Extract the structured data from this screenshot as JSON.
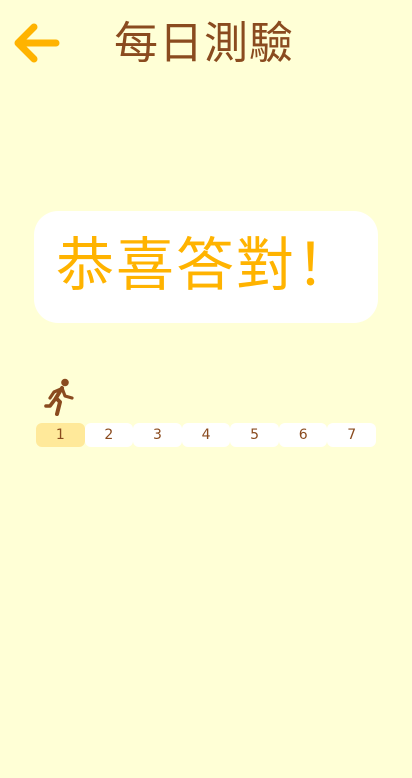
{
  "header": {
    "back_icon": "arrow-left-icon",
    "title": "每日測驗"
  },
  "result": {
    "message": "恭喜答對！"
  },
  "progress": {
    "runner_icon": "running-person-icon",
    "current": 1,
    "steps": [
      "1",
      "2",
      "3",
      "4",
      "5",
      "6",
      "7"
    ]
  },
  "colors": {
    "background": "#FFFFD6",
    "accent": "#FFB300",
    "title": "#8A4B1F",
    "active_step": "#FFE99A",
    "card": "#FFFFFF"
  }
}
